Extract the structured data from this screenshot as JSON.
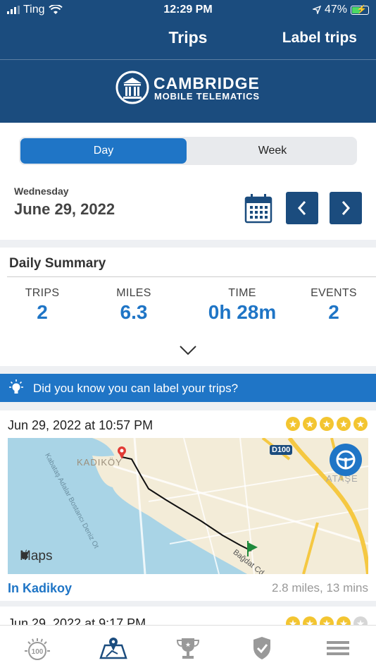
{
  "status": {
    "carrier": "Ting",
    "time": "12:29 PM",
    "battery": "47%"
  },
  "nav": {
    "title": "Trips",
    "action": "Label trips"
  },
  "brand": {
    "line1": "CAMBRIDGE",
    "line2": "MOBILE TELEMATICS"
  },
  "segment": {
    "day": "Day",
    "week": "Week",
    "selected": "Day"
  },
  "date": {
    "weekday": "Wednesday",
    "full": "June 29, 2022"
  },
  "summary": {
    "title": "Daily Summary",
    "stats": [
      {
        "label": "TRIPS",
        "value": "2"
      },
      {
        "label": "MILES",
        "value": "6.3"
      },
      {
        "label": "TIME",
        "value": "0h 28m"
      },
      {
        "label": "EVENTS",
        "value": "2"
      }
    ]
  },
  "tip": {
    "text": "Did you know you can label your trips?"
  },
  "trips": [
    {
      "title": "Jun 29, 2022 at 10:57 PM",
      "stars": 5,
      "location": "In Kadikoy",
      "distance": "2.8 miles, 13 mins",
      "map": {
        "district": "KADIKÖY",
        "district2": "ATAŞE",
        "road": "D100",
        "street": "Bağdat Cd.",
        "coast": "Kabataş Adalar Bostancı Deniz Ot",
        "attribution": "Maps"
      }
    },
    {
      "title": "Jun 29, 2022 at 9:17 PM",
      "stars": 4
    }
  ],
  "tabs": [
    "score-icon",
    "trips-map-icon",
    "trophy-icon",
    "shield-check-icon",
    "menu-icon"
  ],
  "colors": {
    "navy": "#1b4c7e",
    "accent": "#1f75c6",
    "star": "#f3c531"
  }
}
